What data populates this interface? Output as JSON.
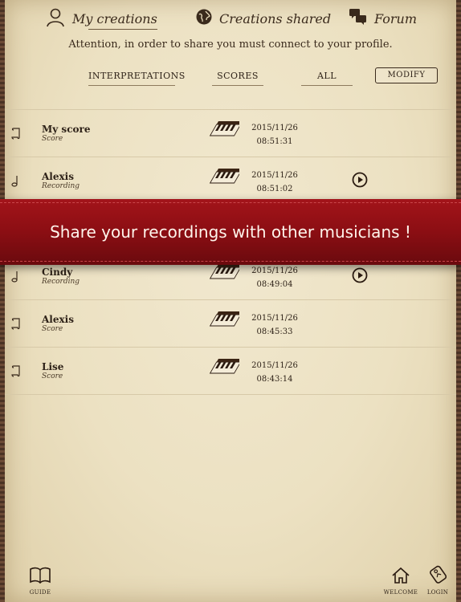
{
  "nav": {
    "my_creations": "My creations",
    "creations_shared": "Creations shared",
    "forum": "Forum",
    "icons": [
      "user-icon",
      "globe-icon",
      "chat-bubbles-icon"
    ]
  },
  "attention": "Attention, in order to share you must connect to your profile.",
  "filters": {
    "interpretations": "INTERPRETATIONS",
    "scores": "SCORES",
    "all": "ALL",
    "modify": "MODIFY"
  },
  "rows": [
    {
      "name": "My score",
      "type": "Score",
      "date": "2015/11/26",
      "time": "08:51:31",
      "icon": "scroll-icon",
      "play": false
    },
    {
      "name": "Alexis",
      "type": "Recording",
      "date": "2015/11/26",
      "time": "08:51:02",
      "icon": "note-icon",
      "play": true
    },
    {
      "name": "Cindy",
      "type": "Recording",
      "date": "2015/11/26",
      "time": "08:49:04",
      "icon": "note-icon",
      "play": true
    },
    {
      "name": "Alexis",
      "type": "Score",
      "date": "2015/11/26",
      "time": "08:45:33",
      "icon": "scroll-icon",
      "play": false
    },
    {
      "name": "Lise",
      "type": "Score",
      "date": "2015/11/26",
      "time": "08:43:14",
      "icon": "scroll-icon",
      "play": false
    }
  ],
  "banner": "Share your recordings with other musicians !",
  "bottom": {
    "guide": "GUIDE",
    "welcome": "WELCOME",
    "login": "LOGIN"
  },
  "colors": {
    "paper": "#ece1c2",
    "ink": "#2e2218",
    "banner_red": "#8b0e13",
    "frame": "#5a4030"
  }
}
